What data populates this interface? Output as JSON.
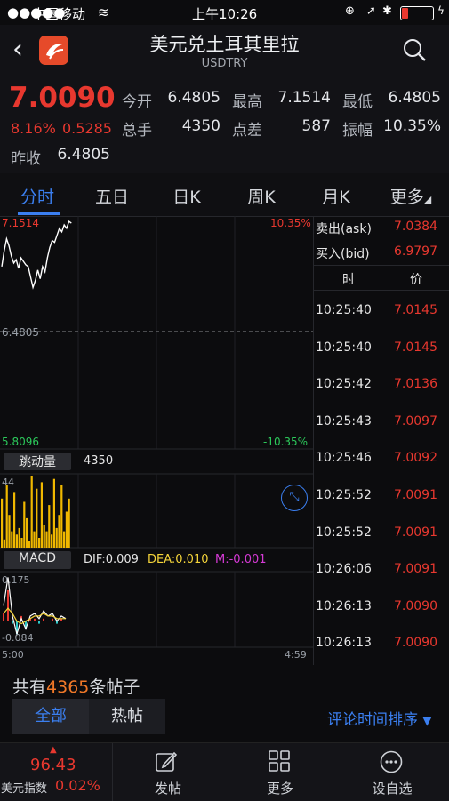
{
  "status_bar": {
    "carrier": "中国移动",
    "time": "上午10:26"
  },
  "header": {
    "title": "美元兑土耳其里拉",
    "subtitle": "USDTRY"
  },
  "quote": {
    "price": "7.0090",
    "change_pct": "8.16%",
    "change": "0.5285",
    "prev_label": "昨收",
    "prev_value": "6.4805",
    "stats": [
      {
        "label": "今开",
        "value": "6.4805"
      },
      {
        "label": "最高",
        "value": "7.1514"
      },
      {
        "label": "最低",
        "value": "6.4805"
      },
      {
        "label": "总手",
        "value": "4350"
      },
      {
        "label": "点差",
        "value": "587"
      },
      {
        "label": "振幅",
        "value": "10.35%"
      }
    ]
  },
  "tabs": [
    "分时",
    "五日",
    "日K",
    "周K",
    "月K",
    "更多"
  ],
  "chart": {
    "top_price": "7.1514",
    "top_pct": "10.35%",
    "mid_price": "6.4805",
    "bottom_price": "5.8096",
    "bottom_pct": "-10.35%",
    "volume_label": "跳动量",
    "volume_value": "4350",
    "volume_max": "44",
    "macd_label": "MACD",
    "dif": "DIF:0.009",
    "dea": "DEA:0.010",
    "m": "M:-0.001",
    "macd_top": "0.175",
    "macd_bottom": "-0.084",
    "time_start": "5:00",
    "time_end": "4:59"
  },
  "chart_data": {
    "type": "line",
    "price_ylim": [
      5.8096,
      7.1514
    ],
    "price": [
      6.86,
      6.95,
      7.02,
      6.98,
      6.92,
      6.88,
      6.9,
      6.85,
      6.91,
      6.89,
      6.87,
      6.86,
      6.8,
      6.74,
      6.78,
      6.84,
      6.79,
      6.86,
      6.83,
      6.91,
      6.97,
      7.01,
      7.0,
      7.04,
      7.08,
      7.06,
      7.1,
      7.08,
      7.12,
      7.11
    ],
    "volume": [
      30,
      5,
      38,
      20,
      10,
      34,
      8,
      12,
      6,
      28,
      18,
      4,
      44,
      10,
      36,
      6,
      40,
      14,
      10,
      26,
      8,
      42,
      12,
      20,
      38,
      10,
      22,
      30
    ],
    "dif": [
      0.06,
      0.17,
      0.02,
      -0.05,
      0.01,
      -0.03,
      0.02,
      0.03,
      0.01,
      0.04,
      0.02,
      0.03,
      0.0,
      0.02,
      0.01
    ],
    "dea": [
      0.03,
      0.05,
      0.03,
      0.0,
      -0.01,
      0.0,
      0.01,
      0.02,
      0.02,
      0.03,
      0.02,
      0.02,
      0.01,
      0.01,
      0.01
    ]
  },
  "trades": {
    "ask_label": "卖出(ask)",
    "ask": "7.0384",
    "bid_label": "买入(bid)",
    "bid": "6.9797",
    "col_time": "时",
    "col_price": "价",
    "rows": [
      {
        "time": "10:25:40",
        "price": "7.0145"
      },
      {
        "time": "10:25:40",
        "price": "7.0145"
      },
      {
        "time": "10:25:42",
        "price": "7.0136"
      },
      {
        "time": "10:25:43",
        "price": "7.0097"
      },
      {
        "time": "10:25:46",
        "price": "7.0092"
      },
      {
        "time": "10:25:52",
        "price": "7.0091"
      },
      {
        "time": "10:25:52",
        "price": "7.0091"
      },
      {
        "time": "10:26:06",
        "price": "7.0091"
      },
      {
        "time": "10:26:13",
        "price": "7.0090"
      },
      {
        "time": "10:26:13",
        "price": "7.0090"
      }
    ]
  },
  "comments": {
    "prefix": "共有",
    "count": "4365",
    "suffix": "条帖子",
    "tab_all": "全部",
    "tab_hot": "热帖",
    "sort": "评论时间排序"
  },
  "bottom": {
    "index_value": "96.43",
    "index_name": "美元指数",
    "index_pct": "0.02%",
    "post": "发帖",
    "more": "更多",
    "watch": "设自选"
  },
  "colors": {
    "up": "#e8382f",
    "down": "#2cc95b",
    "accent": "#3b7ff0",
    "volume": "#f0b800"
  }
}
